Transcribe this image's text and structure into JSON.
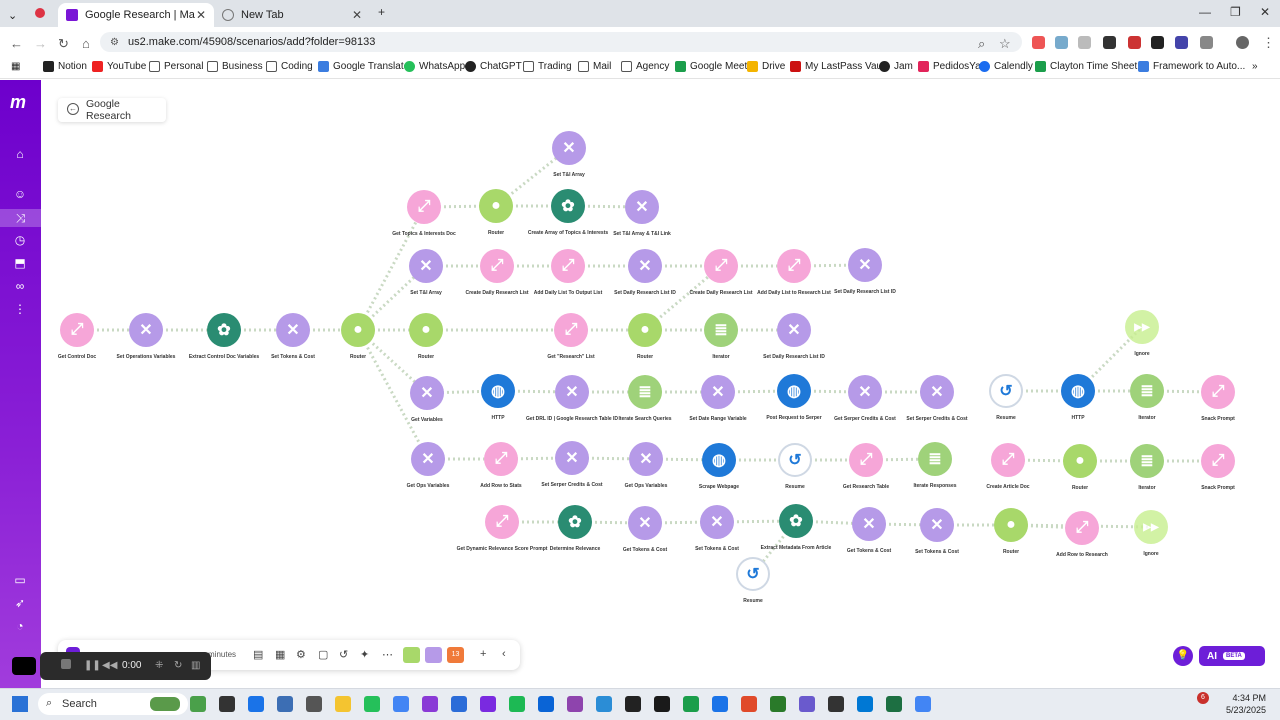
{
  "browser": {
    "tabs": [
      {
        "title": "Google Research | Make - F",
        "active": true
      },
      {
        "title": "New Tab",
        "active": false
      }
    ],
    "url": "us2.make.com/45908/scenarios/add?folder=98133",
    "bookmarks": [
      "Notion",
      "YouTube",
      "Personal",
      "Business",
      "Coding",
      "Google Translate",
      "WhatsApp",
      "ChatGPT",
      "Trading",
      "Mail",
      "Agency",
      "Google Meet",
      "Drive",
      "My LastPass Vault",
      "Jam",
      "PedidosYa",
      "Calendly",
      "Clayton Time Sheet...",
      "Framework to Auto..."
    ]
  },
  "scenario": {
    "title": "Google Research",
    "nodes": [
      {
        "label": "Set T&I Array",
        "kind": "tools"
      },
      {
        "label": "Get Topics & Interests Doc",
        "kind": "pink"
      },
      {
        "label": "Router",
        "kind": "router"
      },
      {
        "label": "Create Array of Topics & Interests",
        "kind": "openai"
      },
      {
        "label": "Set T&I Array & T&I Link",
        "kind": "tools"
      },
      {
        "label": "Set T&I Array",
        "kind": "tools"
      },
      {
        "label": "Create Daily Research List",
        "kind": "pink"
      },
      {
        "label": "Add Daily List To Output List",
        "kind": "pink"
      },
      {
        "label": "Set Daily Research List ID",
        "kind": "tools"
      },
      {
        "label": "Create Daily Research List",
        "kind": "pink"
      },
      {
        "label": "Add Daily List to Research List",
        "kind": "pink"
      },
      {
        "label": "Set Daily Research List ID",
        "kind": "tools"
      },
      {
        "label": "Get Control Doc",
        "kind": "pink"
      },
      {
        "label": "Set Operations Variables",
        "kind": "tools"
      },
      {
        "label": "Extract Control Doc Variables",
        "kind": "openai"
      },
      {
        "label": "Set Tokens & Cost",
        "kind": "tools"
      },
      {
        "label": "Router",
        "kind": "router"
      },
      {
        "label": "Router",
        "kind": "router"
      },
      {
        "label": "Get \"Research\" List",
        "kind": "pink"
      },
      {
        "label": "Router",
        "kind": "router"
      },
      {
        "label": "Iterator",
        "kind": "iter"
      },
      {
        "label": "Set Daily Research List ID",
        "kind": "tools"
      },
      {
        "label": "Ignore",
        "kind": "ignore"
      },
      {
        "label": "Get Variables",
        "kind": "tools"
      },
      {
        "label": "HTTP",
        "kind": "http"
      },
      {
        "label": "Get DRL ID | Google Research Table ID",
        "kind": "tools"
      },
      {
        "label": "Iterate Search Queries",
        "kind": "iter"
      },
      {
        "label": "Set Date Range Variable",
        "kind": "tools"
      },
      {
        "label": "Post Request to Serper",
        "kind": "http"
      },
      {
        "label": "Get Serper Credits & Cost",
        "kind": "tools"
      },
      {
        "label": "Set Serper Credits & Cost",
        "kind": "tools"
      },
      {
        "label": "Resume",
        "kind": "resume"
      },
      {
        "label": "HTTP",
        "kind": "http"
      },
      {
        "label": "Iterator",
        "kind": "iter"
      },
      {
        "label": "Snack Prompt",
        "kind": "pink"
      },
      {
        "label": "Get Ops Variables",
        "kind": "tools"
      },
      {
        "label": "Add Row to Stats",
        "kind": "pink"
      },
      {
        "label": "Set Serper Credits & Cost",
        "kind": "tools"
      },
      {
        "label": "Get Ops Variables",
        "kind": "tools"
      },
      {
        "label": "Scrape Webpage",
        "kind": "http"
      },
      {
        "label": "Resume",
        "kind": "resume"
      },
      {
        "label": "Get Research Table",
        "kind": "pink"
      },
      {
        "label": "Iterate Responses",
        "kind": "iter"
      },
      {
        "label": "Create Article Doc",
        "kind": "pink"
      },
      {
        "label": "Router",
        "kind": "router"
      },
      {
        "label": "Iterator",
        "kind": "iter"
      },
      {
        "label": "Snack Prompt",
        "kind": "pink"
      },
      {
        "label": "Get Dynamic Relevance Score Prompt",
        "kind": "pink"
      },
      {
        "label": "Determine Relevance",
        "kind": "openai"
      },
      {
        "label": "Get Tokens & Cost",
        "kind": "tools"
      },
      {
        "label": "Set Tokens & Cost",
        "kind": "tools"
      },
      {
        "label": "Extract Metadata From Article",
        "kind": "openai"
      },
      {
        "label": "Get Tokens & Cost",
        "kind": "tools"
      },
      {
        "label": "Set Tokens & Cost",
        "kind": "tools"
      },
      {
        "label": "Router",
        "kind": "router"
      },
      {
        "label": "Add Row to Research",
        "kind": "pink"
      },
      {
        "label": "Ignore",
        "kind": "ignore"
      },
      {
        "label": "Resume",
        "kind": "resume"
      }
    ]
  },
  "bottom_bar": {
    "minutes_label": "minutes",
    "badge": "13"
  },
  "recorder": {
    "time": "0:00"
  },
  "ai": {
    "label": "AI",
    "beta": "BETA"
  },
  "colors": {
    "pink": "#f6a6d8",
    "tools": "#b69ae8",
    "router": "#a8d86a",
    "openai": "#2a8c72",
    "http": "#1f79d8",
    "iter": "#9fd27a",
    "resume": "#ffffff",
    "ignore": "#c8ef8f"
  },
  "taskbar": {
    "search_placeholder": "Search",
    "time": "4:34 PM",
    "date": "5/23/2025",
    "notif": "6"
  }
}
